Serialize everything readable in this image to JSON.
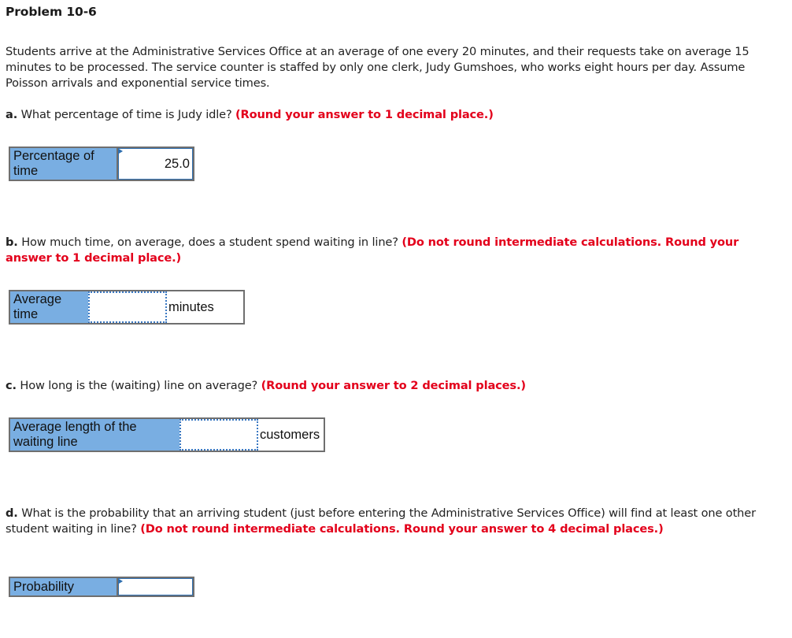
{
  "problem": {
    "title": "Problem 10-6",
    "intro": "Students arrive at the Administrative Services Office at an average of one every 20 minutes, and their requests take on average 15 minutes to be processed. The service counter is staffed by only one clerk, Judy Gumshoes, who works eight hours per day. Assume Poisson arrivals and exponential service times."
  },
  "questions": [
    {
      "label": "a.",
      "text": " What percentage of time is Judy idle? ",
      "instruction": "(Round your answer to 1 decimal place.)",
      "answer_row": {
        "field_label": "Percentage of time",
        "value": "25.0",
        "placeholder": "",
        "unit": ""
      }
    },
    {
      "label": "b.",
      "text": " How much time, on average, does a student spend waiting in line? ",
      "instruction": "(Do not round intermediate calculations. Round your answer to 1 decimal place.)",
      "answer_row": {
        "field_label": "Average time",
        "value": "",
        "placeholder": "",
        "unit": "minutes"
      }
    },
    {
      "label": "c.",
      "text": " How long is the (waiting) line on average? ",
      "instruction": "(Round your answer to 2 decimal places.)",
      "answer_row": {
        "field_label": "Average length of the waiting line",
        "value": "",
        "placeholder": "",
        "unit": "customers"
      }
    },
    {
      "label": "d.",
      "text": " What is the probability that an arriving student (just before entering the Administrative Services Office) will find at least one other student waiting in line? ",
      "instruction": "(Do not round intermediate calculations. Round your answer to 4 decimal places.)",
      "answer_row": {
        "field_label": "Probability",
        "value": "",
        "placeholder": "",
        "unit": ""
      }
    }
  ],
  "colors": {
    "instruction_red": "#e3001b",
    "label_cell_blue": "#79aee2",
    "input_border_blue": "#2f6fb0",
    "table_border_gray": "#6f6f6f"
  }
}
